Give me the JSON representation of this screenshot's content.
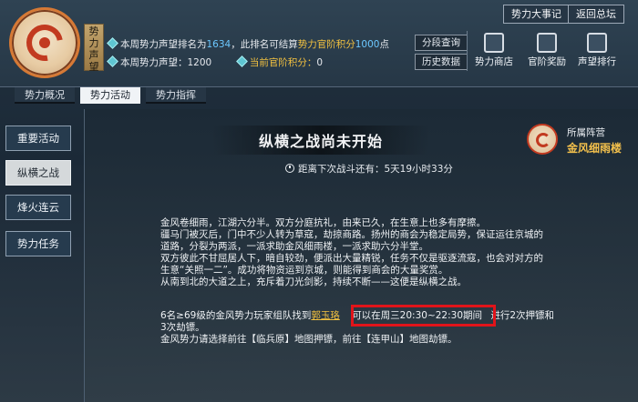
{
  "header": {
    "side_tag": "势力声望",
    "line1": {
      "pre": "本周势力声望排名为",
      "rank": "1634",
      "mid": "，此排名可结算",
      "hl": "势力官阶积分",
      "points": "1000",
      "post": "点"
    },
    "line2": {
      "label": "本周势力声望：",
      "value": "1200",
      "rank_label": "当前官阶积分：",
      "rank_value": "0"
    },
    "btn_segment": "分段查询",
    "btn_history": "历史数据",
    "icons": [
      {
        "label": "势力商店",
        "icon": "shop-icon"
      },
      {
        "label": "官阶奖励",
        "icon": "reward-icon"
      },
      {
        "label": "声望排行",
        "icon": "ranking-icon"
      }
    ],
    "top_buttons": [
      "势力大事记",
      "返回总坛"
    ]
  },
  "tabs": [
    {
      "label": "势力概况"
    },
    {
      "label": "势力活动",
      "active": true
    },
    {
      "label": "势力指挥"
    }
  ],
  "nav": [
    {
      "label": "重要活动"
    },
    {
      "label": "纵横之战",
      "active": true
    },
    {
      "label": "烽火连云"
    },
    {
      "label": "势力任务"
    }
  ],
  "main": {
    "title": "纵横之战尚未开始",
    "countdown_label": "距离下次战斗还有：",
    "countdown_value": "5天19小时33分",
    "faction_label": "所属阵营",
    "faction_name": "金风细雨楼",
    "story": [
      "金风卷细雨，江湖六分半。双方分庭抗礼，由来已久，在生意上也多有摩擦。",
      "疆马门被灭后，门中不少人转为草寇，劫掠商路。扬州的商会为稳定局势，保证运往京城的",
      "道路，分裂为两派，一派求助金风细雨楼，一派求助六分半堂。",
      "双方彼此不甘屈居人下，暗自较劲，便派出大量精锐，任务不仅是驱逐流寇，也会对对方的",
      "生意“关照一二”。成功将物资运到京城，则能得到商会的大量奖赏。",
      "从南到北的大道之上，充斥着刀光剑影，持续不断——这便是纵横之战。"
    ],
    "tips_line1_pre": "6名≥69级的金风势力玩家组队找到",
    "tips_link": "郭玉珞",
    "tips_highlight": "可以在周三20:30~22:30期间",
    "tips_line1_post": "进行2次押镖和",
    "tips_line2": "3次劫镖。",
    "tips_line3": "金风势力请选择前往【临兵原】地图押镖，前往【连甲山】地图劫镖。"
  },
  "colors": {
    "accent_gold": "#f1c040",
    "number_blue": "#6cc7ff",
    "highlight_red": "#e1141a"
  }
}
